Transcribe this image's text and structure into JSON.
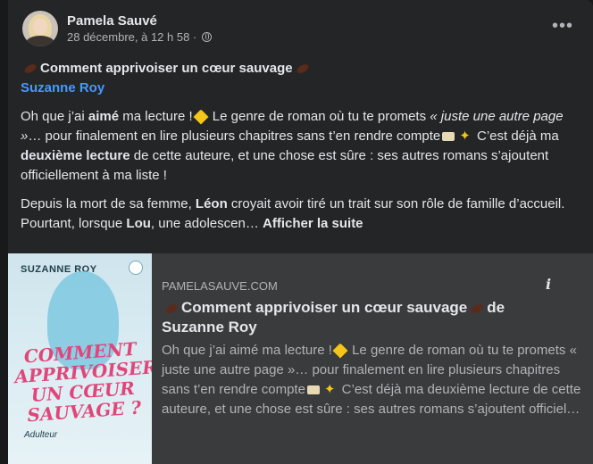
{
  "post": {
    "author": "Pamela Sauvé",
    "date": "28 décembre, à 12 h 58 ·",
    "more_label": "•••",
    "title": "Comment apprivoiser un cœur sauvage",
    "book_author": "Suzanne Roy",
    "p1": {
      "a": "Oh que j’ai ",
      "b": "aimé",
      "c": " ma lecture !",
      "d": " Le genre de roman où tu te promets ",
      "e": "« juste une autre page »",
      "f": "… pour finalement en lire plusieurs chapitres sans t’en rendre compte",
      "g": " C’est déjà ma ",
      "h": "deuxième lecture",
      "i": " de cette auteure, et une chose est sûre : ses autres romans s’ajoutent officiellement à ma liste !"
    },
    "p2": {
      "a": "Depuis la mort de sa femme, ",
      "b": "Léon",
      "c": " croyait avoir tiré un trait sur son rôle de famille d’accueil. Pourtant, lorsque ",
      "d": "Lou",
      "e": ", une adolescen…",
      "see_more": "Afficher la suite"
    }
  },
  "link": {
    "domain": "PAMELASAUVE.COM",
    "title_a": "Comment apprivoiser un cœur sauvage",
    "title_b": "de",
    "title_c": "Suzanne Roy",
    "desc_a": "Oh que j’ai aimé ma lecture !",
    "desc_b": " Le genre de roman où tu te promets « juste une autre page »… pour finalement en lire plusieurs chapitres sans t’en rendre compte",
    "desc_c": " C’est déjà ma deuxième lecture de cette auteure, et une chose est sûre : ses autres romans s’ajoutent officiel…",
    "info_label": "i",
    "cover": {
      "author": "SUZANNE ROY",
      "title": "COMMENT APPRIVOISER UN CŒUR SAUVAGE ?",
      "publisher": "Adulteur"
    }
  }
}
